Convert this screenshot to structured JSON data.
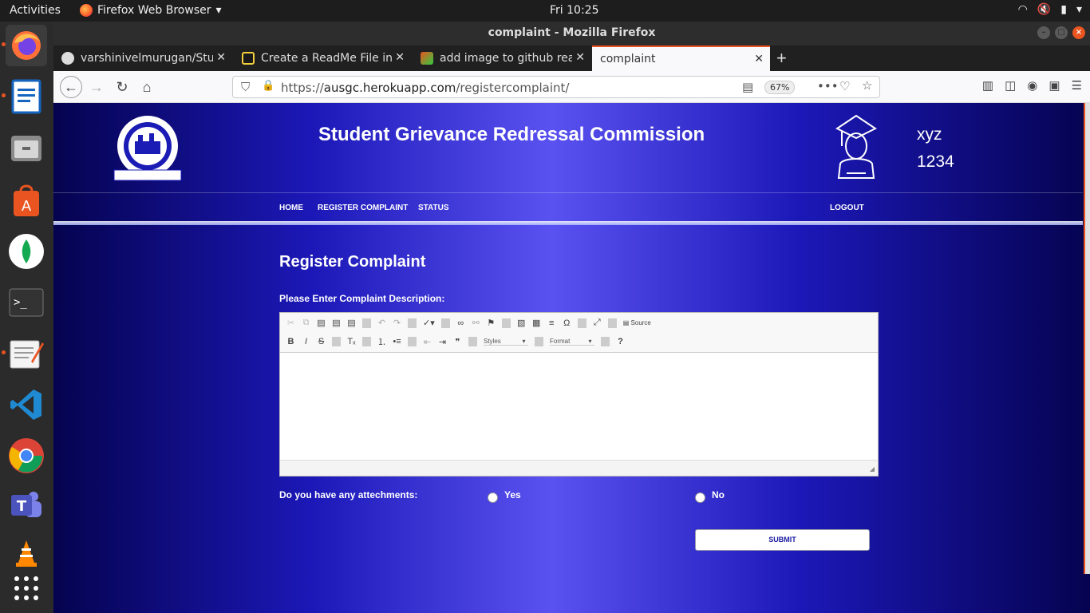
{
  "system": {
    "activities": "Activities",
    "app_name": "Firefox Web Browser",
    "clock": "Fri 10:25"
  },
  "window": {
    "title": "complaint - Mozilla Firefox"
  },
  "tabs": [
    {
      "label": "varshinivelmurugan/Stud"
    },
    {
      "label": "Create a ReadMe File in G"
    },
    {
      "label": "add image to github read"
    },
    {
      "label": "complaint"
    }
  ],
  "navbar": {
    "url_prefix": "https://",
    "url_domain": "ausgc.herokuapp.com",
    "url_path": "/registercomplaint/",
    "zoom": "67%"
  },
  "site": {
    "title": "Student Grievance Redressal Commission",
    "user_name": "xyz",
    "user_id": "1234",
    "nav": {
      "home": "HOME",
      "register": "REGISTER COMPLAINT",
      "status": "STATUS",
      "logout": "LOGOUT"
    }
  },
  "form": {
    "heading": "Register Complaint",
    "description_label": "Please Enter Complaint Description:",
    "editor": {
      "source_label": "Source",
      "styles": "Styles",
      "format": "Format"
    },
    "attachments_label": "Do you have any attechments:",
    "yes_label": "Yes",
    "no_label": "No",
    "submit_label": "SUBMIT"
  }
}
